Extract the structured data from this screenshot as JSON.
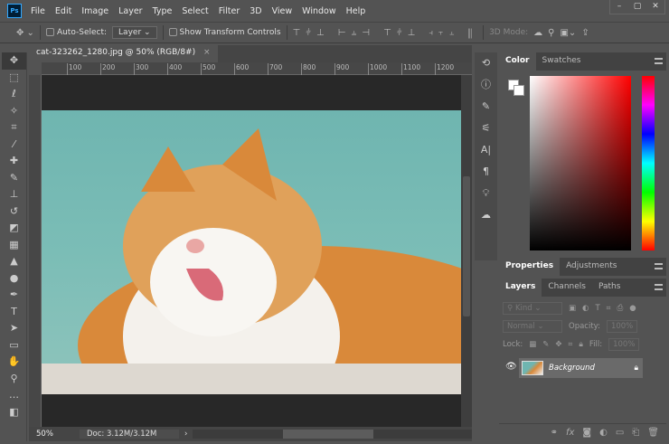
{
  "app": {
    "logo": "Ps"
  },
  "menu": [
    "File",
    "Edit",
    "Image",
    "Layer",
    "Type",
    "Select",
    "Filter",
    "3D",
    "View",
    "Window",
    "Help"
  ],
  "window_controls": [
    "–",
    "▢",
    "✕"
  ],
  "options": {
    "auto_select_label": "Auto-Select:",
    "auto_select_value": "Layer",
    "show_transform_label": "Show Transform Controls",
    "mode_label": "3D Mode:"
  },
  "document": {
    "tab_title": "cat-323262_1280.jpg @ 50% (RGB/8#)",
    "close": "×",
    "ruler_ticks": [
      "100",
      "200",
      "300",
      "400",
      "500",
      "600",
      "700",
      "800",
      "900",
      "1000",
      "1100",
      "1200"
    ],
    "zoom": "50%",
    "doc_size": "Doc: 3.12M/3.12M"
  },
  "color_panel": {
    "tabs": [
      "Color",
      "Swatches"
    ],
    "foreground": "#ffffff",
    "background": "#ffffff"
  },
  "properties_panel": {
    "tabs": [
      "Properties",
      "Adjustments"
    ]
  },
  "layers_panel": {
    "tabs": [
      "Layers",
      "Channels",
      "Paths"
    ],
    "filter_label": "Kind",
    "blend_mode": "Normal",
    "opacity_label": "Opacity:",
    "opacity_value": "100%",
    "lock_label": "Lock:",
    "fill_label": "Fill:",
    "fill_value": "100%",
    "layers": [
      {
        "name": "Background",
        "visible": true,
        "locked": true
      }
    ]
  }
}
